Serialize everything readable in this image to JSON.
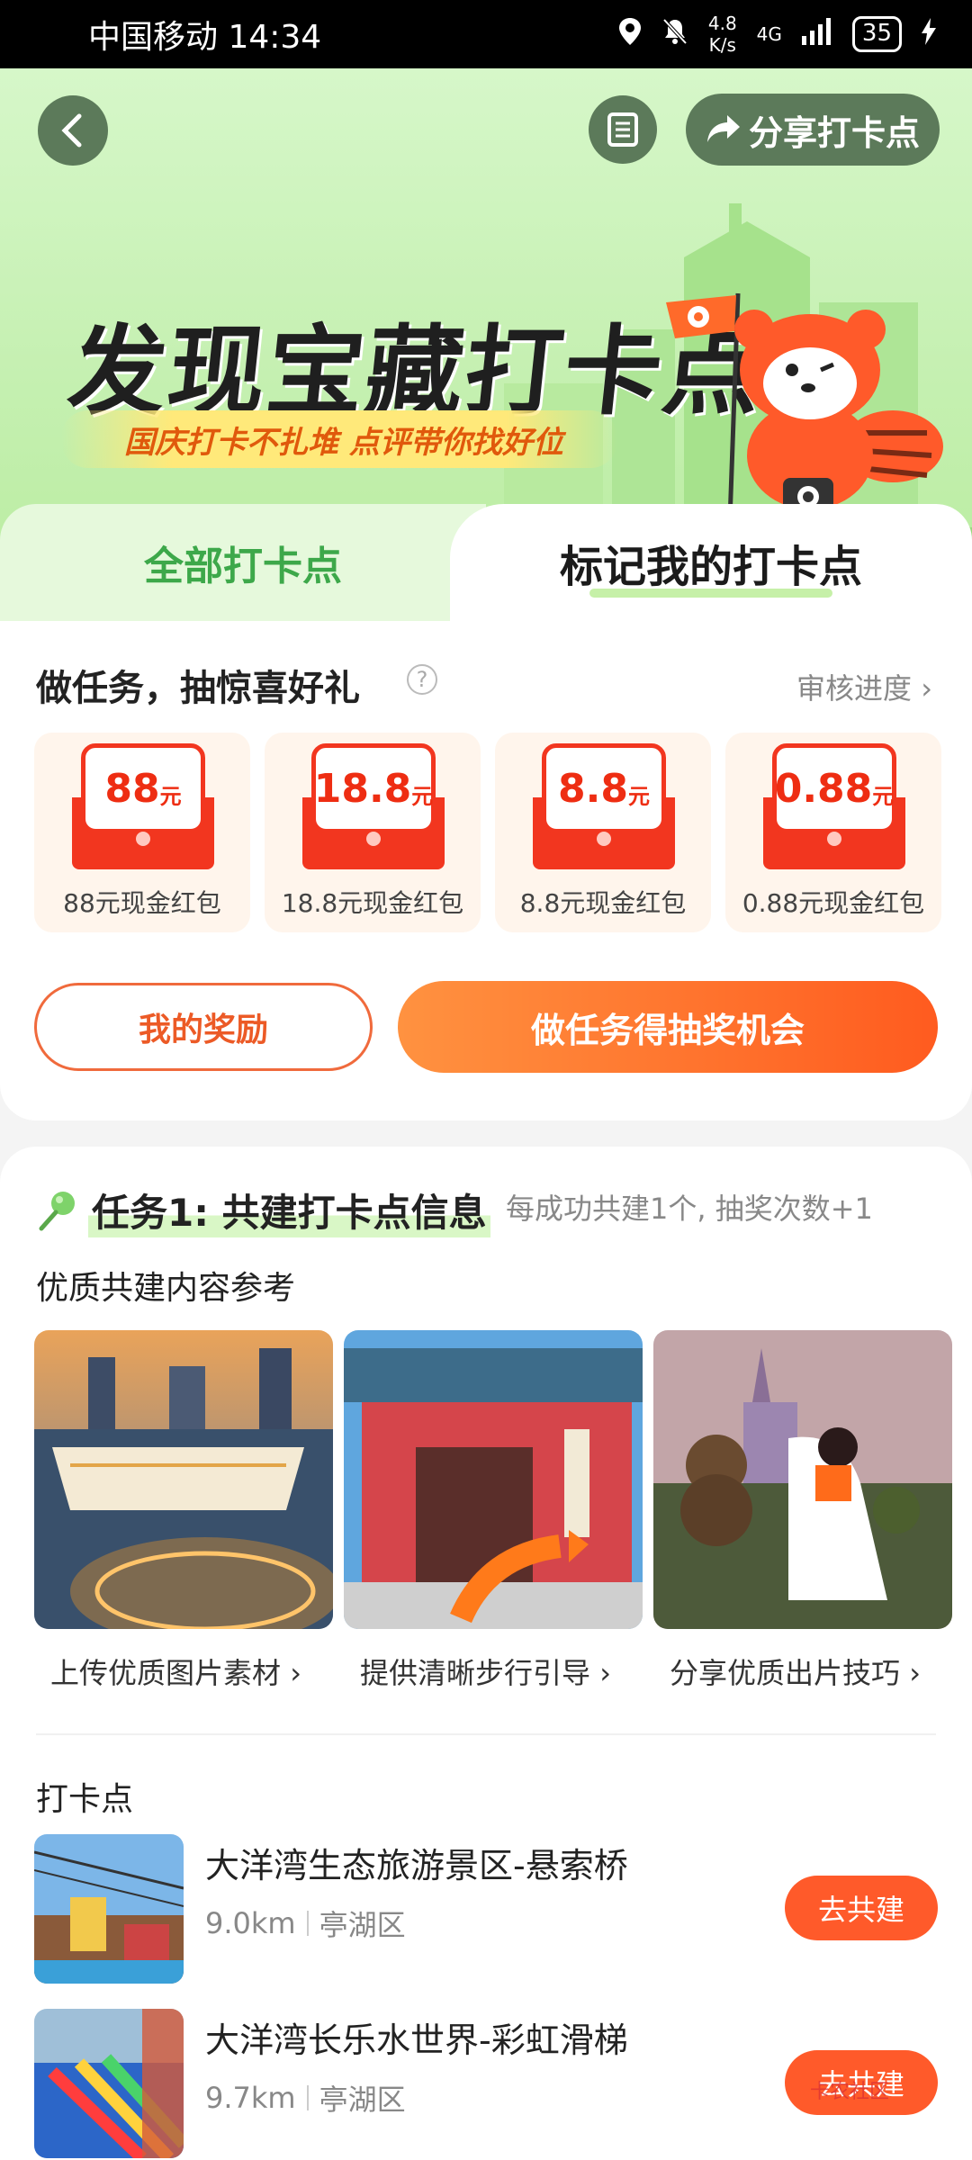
{
  "status_bar": {
    "carrier_time": "中国移动 14:34",
    "speed": "4.8\nK/s",
    "network": "4G",
    "battery": "35"
  },
  "header": {
    "share_label": "分享打卡点"
  },
  "hero": {
    "title": "发现宝藏打卡点",
    "subtitle": "国庆打卡不扎堆 点评带你找好位"
  },
  "tabs": [
    {
      "label": "全部打卡点"
    },
    {
      "label": "标记我的打卡点"
    }
  ],
  "tasks": {
    "title": "做任务，抽惊喜好礼",
    "audit_link": "审核进度",
    "prizes": [
      {
        "amount": "88",
        "unit": "元",
        "label": "88元现金红包"
      },
      {
        "amount": "18.8",
        "unit": "元",
        "label": "18.8元现金红包"
      },
      {
        "amount": "8.8",
        "unit": "元",
        "label": "8.8元现金红包"
      },
      {
        "amount": "0.88",
        "unit": "元",
        "label": "0.88元现金红包"
      }
    ],
    "my_rewards_label": "我的奖励",
    "do_task_label": "做任务得抽奖机会"
  },
  "cobuild": {
    "task_title": "任务1: 共建打卡点信息",
    "task_note": "每成功共建1个, 抽奖次数+1",
    "ref_title": "优质共建内容参考",
    "refs": [
      {
        "caption": "上传优质图片素材"
      },
      {
        "caption": "提供清晰步行引导"
      },
      {
        "caption": "分享优质出片技巧"
      }
    ],
    "spots_title": "打卡点",
    "spots": [
      {
        "name": "大洋湾生态旅游景区-悬索桥",
        "distance": "9.0km",
        "district": "亭湖区",
        "button": "去共建"
      },
      {
        "name": "大洋湾长乐水世界-彩虹滑梯",
        "distance": "9.7km",
        "district": "亭湖区",
        "button": "去共建"
      }
    ]
  },
  "watermark": "卡农社区",
  "colors": {
    "primary_orange": "#ff5a2a",
    "hero_green": "#c5f0b1",
    "red_packet": "#f2361f"
  }
}
